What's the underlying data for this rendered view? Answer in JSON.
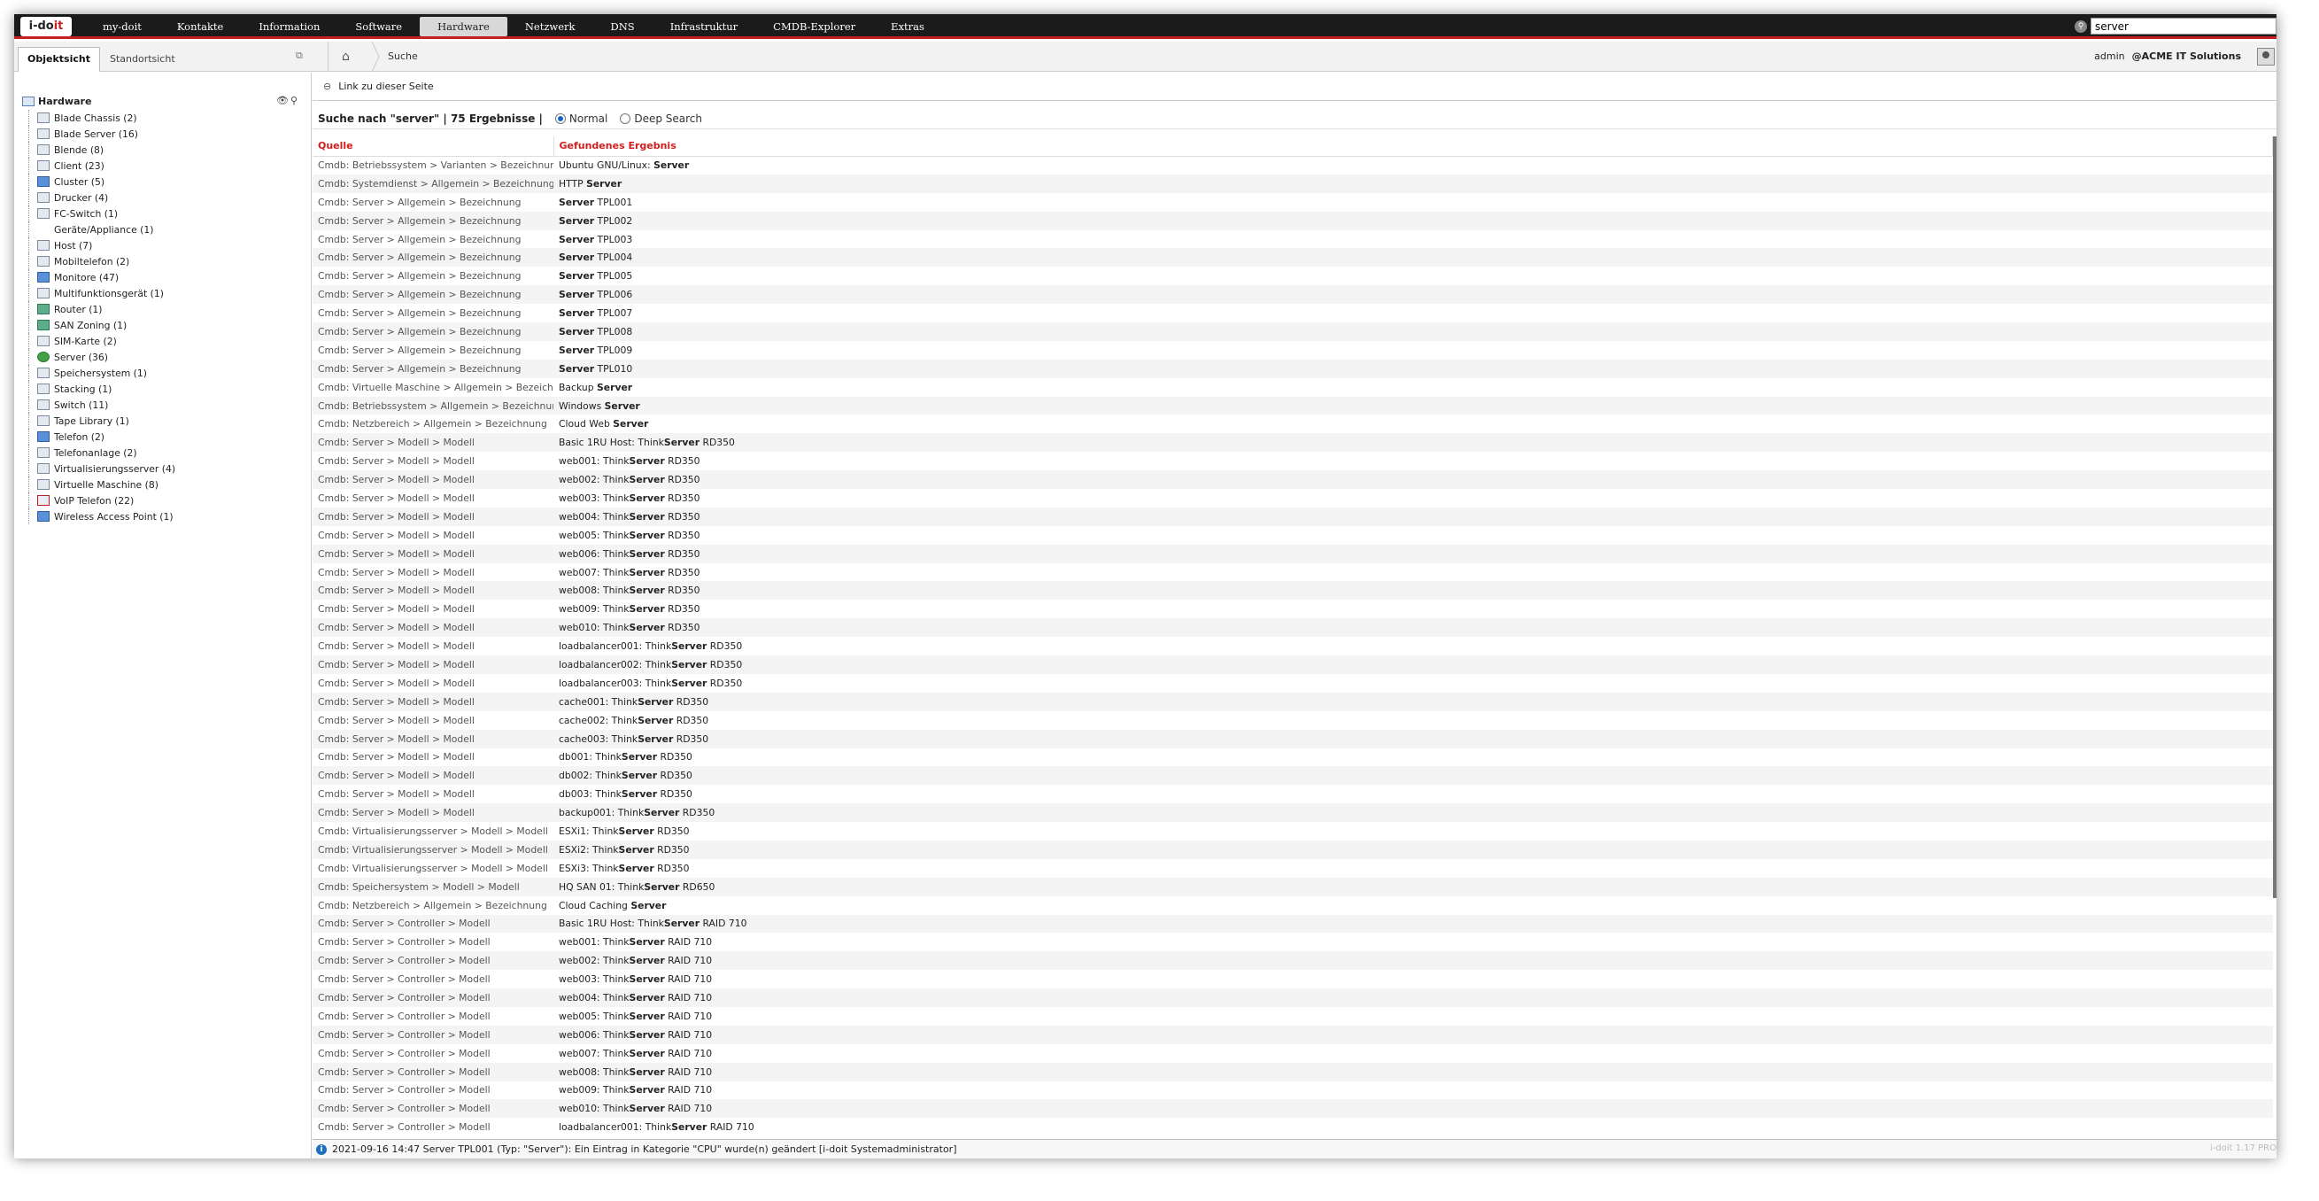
{
  "topbar": {
    "logo": "i-doit",
    "nav": [
      "my-doit",
      "Kontakte",
      "Information",
      "Software",
      "Hardware",
      "Netzwerk",
      "DNS",
      "Infrastruktur",
      "CMDB-Explorer",
      "Extras"
    ],
    "active_nav": "Hardware",
    "search_value": "server"
  },
  "subbar": {
    "tabs": [
      "Objektsicht",
      "Standortsicht"
    ],
    "active_tab": "Objektsicht",
    "breadcrumb": "Suche",
    "user": "admin",
    "tenant": "@ACME IT Solutions"
  },
  "tree": {
    "root": "Hardware",
    "items": [
      {
        "label": "Blade Chassis (2)",
        "icon": "blade-chassis-icon",
        "color": ""
      },
      {
        "label": "Blade Server (16)",
        "icon": "blade-server-icon",
        "color": ""
      },
      {
        "label": "Blende (8)",
        "icon": "blende-icon",
        "color": ""
      },
      {
        "label": "Client (23)",
        "icon": "client-icon",
        "color": ""
      },
      {
        "label": "Cluster (5)",
        "icon": "cluster-icon",
        "color": "blue"
      },
      {
        "label": "Drucker (4)",
        "icon": "printer-icon",
        "color": ""
      },
      {
        "label": "FC-Switch (1)",
        "icon": "fc-switch-icon",
        "color": ""
      },
      {
        "label": "Geräte/Appliance (1)",
        "icon": "appliance-icon",
        "color": "none"
      },
      {
        "label": "Host (7)",
        "icon": "host-icon",
        "color": ""
      },
      {
        "label": "Mobiltelefon (2)",
        "icon": "mobile-phone-icon",
        "color": ""
      },
      {
        "label": "Monitore (47)",
        "icon": "monitor-icon",
        "color": "blue"
      },
      {
        "label": "Multifunktionsgerät (1)",
        "icon": "multifunction-device-icon",
        "color": ""
      },
      {
        "label": "Router (1)",
        "icon": "router-icon",
        "color": "teal"
      },
      {
        "label": "SAN Zoning (1)",
        "icon": "san-zoning-icon",
        "color": "teal"
      },
      {
        "label": "SIM-Karte (2)",
        "icon": "sim-card-icon",
        "color": ""
      },
      {
        "label": "Server (36)",
        "icon": "server-check-icon",
        "color": "green"
      },
      {
        "label": "Speichersystem (1)",
        "icon": "storage-icon",
        "color": ""
      },
      {
        "label": "Stacking (1)",
        "icon": "stacking-icon",
        "color": ""
      },
      {
        "label": "Switch (11)",
        "icon": "switch-icon",
        "color": ""
      },
      {
        "label": "Tape Library (1)",
        "icon": "tape-library-icon",
        "color": ""
      },
      {
        "label": "Telefon (2)",
        "icon": "telephone-icon",
        "color": "blue"
      },
      {
        "label": "Telefonanlage (2)",
        "icon": "phone-system-icon",
        "color": ""
      },
      {
        "label": "Virtualisierungsserver (4)",
        "icon": "virtualization-server-icon",
        "color": ""
      },
      {
        "label": "Virtuelle Maschine (8)",
        "icon": "virtual-machine-icon",
        "color": ""
      },
      {
        "label": "VoIP Telefon (22)",
        "icon": "voip-phone-icon",
        "color": "red"
      },
      {
        "label": "Wireless Access Point (1)",
        "icon": "wireless-ap-icon",
        "color": "blue"
      }
    ]
  },
  "main": {
    "link_label": "Link zu dieser Seite",
    "search_title": "Suche nach \"server\" | 75 Ergebnisse |",
    "radio_normal": "Normal",
    "radio_deep": "Deep Search",
    "columns": [
      "Quelle",
      "Gefundenes Ergebnis"
    ],
    "rows": [
      {
        "src": "Cmdb: Betriebssystem > Varianten > Bezeichnung",
        "pre": "Ubuntu GNU/Linux: ",
        "hit": "Server",
        "post": ""
      },
      {
        "src": "Cmdb: Systemdienst > Allgemein > Bezeichnung",
        "pre": "HTTP ",
        "hit": "Server",
        "post": ""
      },
      {
        "src": "Cmdb: Server > Allgemein > Bezeichnung",
        "pre": "",
        "hit": "Server",
        "post": " TPL001"
      },
      {
        "src": "Cmdb: Server > Allgemein > Bezeichnung",
        "pre": "",
        "hit": "Server",
        "post": " TPL002"
      },
      {
        "src": "Cmdb: Server > Allgemein > Bezeichnung",
        "pre": "",
        "hit": "Server",
        "post": " TPL003"
      },
      {
        "src": "Cmdb: Server > Allgemein > Bezeichnung",
        "pre": "",
        "hit": "Server",
        "post": " TPL004"
      },
      {
        "src": "Cmdb: Server > Allgemein > Bezeichnung",
        "pre": "",
        "hit": "Server",
        "post": " TPL005"
      },
      {
        "src": "Cmdb: Server > Allgemein > Bezeichnung",
        "pre": "",
        "hit": "Server",
        "post": " TPL006"
      },
      {
        "src": "Cmdb: Server > Allgemein > Bezeichnung",
        "pre": "",
        "hit": "Server",
        "post": " TPL007"
      },
      {
        "src": "Cmdb: Server > Allgemein > Bezeichnung",
        "pre": "",
        "hit": "Server",
        "post": " TPL008"
      },
      {
        "src": "Cmdb: Server > Allgemein > Bezeichnung",
        "pre": "",
        "hit": "Server",
        "post": " TPL009"
      },
      {
        "src": "Cmdb: Server > Allgemein > Bezeichnung",
        "pre": "",
        "hit": "Server",
        "post": " TPL010"
      },
      {
        "src": "Cmdb: Virtuelle Maschine > Allgemein > Bezeichnung",
        "pre": "Backup ",
        "hit": "Server",
        "post": ""
      },
      {
        "src": "Cmdb: Betriebssystem > Allgemein > Bezeichnung",
        "pre": "Windows ",
        "hit": "Server",
        "post": ""
      },
      {
        "src": "Cmdb: Netzbereich > Allgemein > Bezeichnung",
        "pre": "Cloud Web ",
        "hit": "Server",
        "post": ""
      },
      {
        "src": "Cmdb: Server > Modell > Modell",
        "pre": "Basic 1RU Host: Think",
        "hit": "Server",
        "post": " RD350"
      },
      {
        "src": "Cmdb: Server > Modell > Modell",
        "pre": "web001: Think",
        "hit": "Server",
        "post": " RD350"
      },
      {
        "src": "Cmdb: Server > Modell > Modell",
        "pre": "web002: Think",
        "hit": "Server",
        "post": " RD350"
      },
      {
        "src": "Cmdb: Server > Modell > Modell",
        "pre": "web003: Think",
        "hit": "Server",
        "post": " RD350"
      },
      {
        "src": "Cmdb: Server > Modell > Modell",
        "pre": "web004: Think",
        "hit": "Server",
        "post": " RD350"
      },
      {
        "src": "Cmdb: Server > Modell > Modell",
        "pre": "web005: Think",
        "hit": "Server",
        "post": " RD350"
      },
      {
        "src": "Cmdb: Server > Modell > Modell",
        "pre": "web006: Think",
        "hit": "Server",
        "post": " RD350"
      },
      {
        "src": "Cmdb: Server > Modell > Modell",
        "pre": "web007: Think",
        "hit": "Server",
        "post": " RD350"
      },
      {
        "src": "Cmdb: Server > Modell > Modell",
        "pre": "web008: Think",
        "hit": "Server",
        "post": " RD350"
      },
      {
        "src": "Cmdb: Server > Modell > Modell",
        "pre": "web009: Think",
        "hit": "Server",
        "post": " RD350"
      },
      {
        "src": "Cmdb: Server > Modell > Modell",
        "pre": "web010: Think",
        "hit": "Server",
        "post": " RD350"
      },
      {
        "src": "Cmdb: Server > Modell > Modell",
        "pre": "loadbalancer001: Think",
        "hit": "Server",
        "post": " RD350"
      },
      {
        "src": "Cmdb: Server > Modell > Modell",
        "pre": "loadbalancer002: Think",
        "hit": "Server",
        "post": " RD350"
      },
      {
        "src": "Cmdb: Server > Modell > Modell",
        "pre": "loadbalancer003: Think",
        "hit": "Server",
        "post": " RD350"
      },
      {
        "src": "Cmdb: Server > Modell > Modell",
        "pre": "cache001: Think",
        "hit": "Server",
        "post": " RD350"
      },
      {
        "src": "Cmdb: Server > Modell > Modell",
        "pre": "cache002: Think",
        "hit": "Server",
        "post": " RD350"
      },
      {
        "src": "Cmdb: Server > Modell > Modell",
        "pre": "cache003: Think",
        "hit": "Server",
        "post": " RD350"
      },
      {
        "src": "Cmdb: Server > Modell > Modell",
        "pre": "db001: Think",
        "hit": "Server",
        "post": " RD350"
      },
      {
        "src": "Cmdb: Server > Modell > Modell",
        "pre": "db002: Think",
        "hit": "Server",
        "post": " RD350"
      },
      {
        "src": "Cmdb: Server > Modell > Modell",
        "pre": "db003: Think",
        "hit": "Server",
        "post": " RD350"
      },
      {
        "src": "Cmdb: Server > Modell > Modell",
        "pre": "backup001: Think",
        "hit": "Server",
        "post": " RD350"
      },
      {
        "src": "Cmdb: Virtualisierungsserver > Modell > Modell",
        "pre": "ESXi1: Think",
        "hit": "Server",
        "post": " RD350"
      },
      {
        "src": "Cmdb: Virtualisierungsserver > Modell > Modell",
        "pre": "ESXi2: Think",
        "hit": "Server",
        "post": " RD350"
      },
      {
        "src": "Cmdb: Virtualisierungsserver > Modell > Modell",
        "pre": "ESXi3: Think",
        "hit": "Server",
        "post": " RD350"
      },
      {
        "src": "Cmdb: Speichersystem > Modell > Modell",
        "pre": "HQ SAN 01: Think",
        "hit": "Server",
        "post": " RD650"
      },
      {
        "src": "Cmdb: Netzbereich > Allgemein > Bezeichnung",
        "pre": "Cloud Caching ",
        "hit": "Server",
        "post": ""
      },
      {
        "src": "Cmdb: Server > Controller > Modell",
        "pre": "Basic 1RU Host: Think",
        "hit": "Server",
        "post": " RAID 710"
      },
      {
        "src": "Cmdb: Server > Controller > Modell",
        "pre": "web001: Think",
        "hit": "Server",
        "post": " RAID 710"
      },
      {
        "src": "Cmdb: Server > Controller > Modell",
        "pre": "web002: Think",
        "hit": "Server",
        "post": " RAID 710"
      },
      {
        "src": "Cmdb: Server > Controller > Modell",
        "pre": "web003: Think",
        "hit": "Server",
        "post": " RAID 710"
      },
      {
        "src": "Cmdb: Server > Controller > Modell",
        "pre": "web004: Think",
        "hit": "Server",
        "post": " RAID 710"
      },
      {
        "src": "Cmdb: Server > Controller > Modell",
        "pre": "web005: Think",
        "hit": "Server",
        "post": " RAID 710"
      },
      {
        "src": "Cmdb: Server > Controller > Modell",
        "pre": "web006: Think",
        "hit": "Server",
        "post": " RAID 710"
      },
      {
        "src": "Cmdb: Server > Controller > Modell",
        "pre": "web007: Think",
        "hit": "Server",
        "post": " RAID 710"
      },
      {
        "src": "Cmdb: Server > Controller > Modell",
        "pre": "web008: Think",
        "hit": "Server",
        "post": " RAID 710"
      },
      {
        "src": "Cmdb: Server > Controller > Modell",
        "pre": "web009: Think",
        "hit": "Server",
        "post": " RAID 710"
      },
      {
        "src": "Cmdb: Server > Controller > Modell",
        "pre": "web010: Think",
        "hit": "Server",
        "post": " RAID 710"
      },
      {
        "src": "Cmdb: Server > Controller > Modell",
        "pre": "loadbalancer001: Think",
        "hit": "Server",
        "post": " RAID 710"
      }
    ]
  },
  "status": {
    "message": "2021-09-16 14:47 Server TPL001 (Typ: \"Server\"): Ein Eintrag in Kategorie \"CPU\" wurde(n) geändert [i-doit Systemadministrator]",
    "version": "i-doit 1.17 PRO"
  },
  "colors": {
    "accent": "#c51f1f",
    "topbar": "#1b1b1b",
    "header_text": "#d11f1f"
  }
}
